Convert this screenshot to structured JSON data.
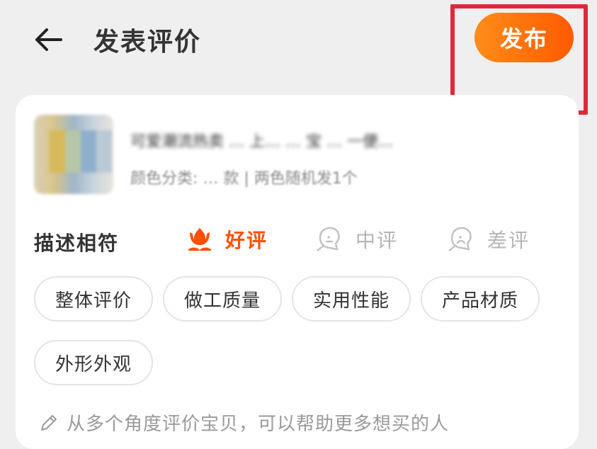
{
  "header": {
    "back_icon": "arrow-left-icon",
    "title": "发表评价",
    "publish_label": "发布"
  },
  "product": {
    "title": "可爱潮流热卖 … 上… … 宝 … 一便...",
    "spec": "颜色分类: … 款 | 两色随机发1个"
  },
  "rating": {
    "label": "描述相符",
    "options": [
      {
        "label": "好评",
        "icon": "flower-icon",
        "selected": true
      },
      {
        "label": "中评",
        "icon": "neutral-face-icon",
        "selected": false
      },
      {
        "label": "差评",
        "icon": "sad-face-icon",
        "selected": false
      }
    ]
  },
  "tags": [
    "整体评价",
    "做工质量",
    "实用性能",
    "产品材质",
    "外形外观"
  ],
  "hint": {
    "icon": "pencil-icon",
    "text": "从多个角度评价宝贝，可以帮助更多想买的人"
  },
  "colors": {
    "accent": "#ff5000",
    "highlight_box": "#e0283c",
    "background": "#efefef"
  }
}
